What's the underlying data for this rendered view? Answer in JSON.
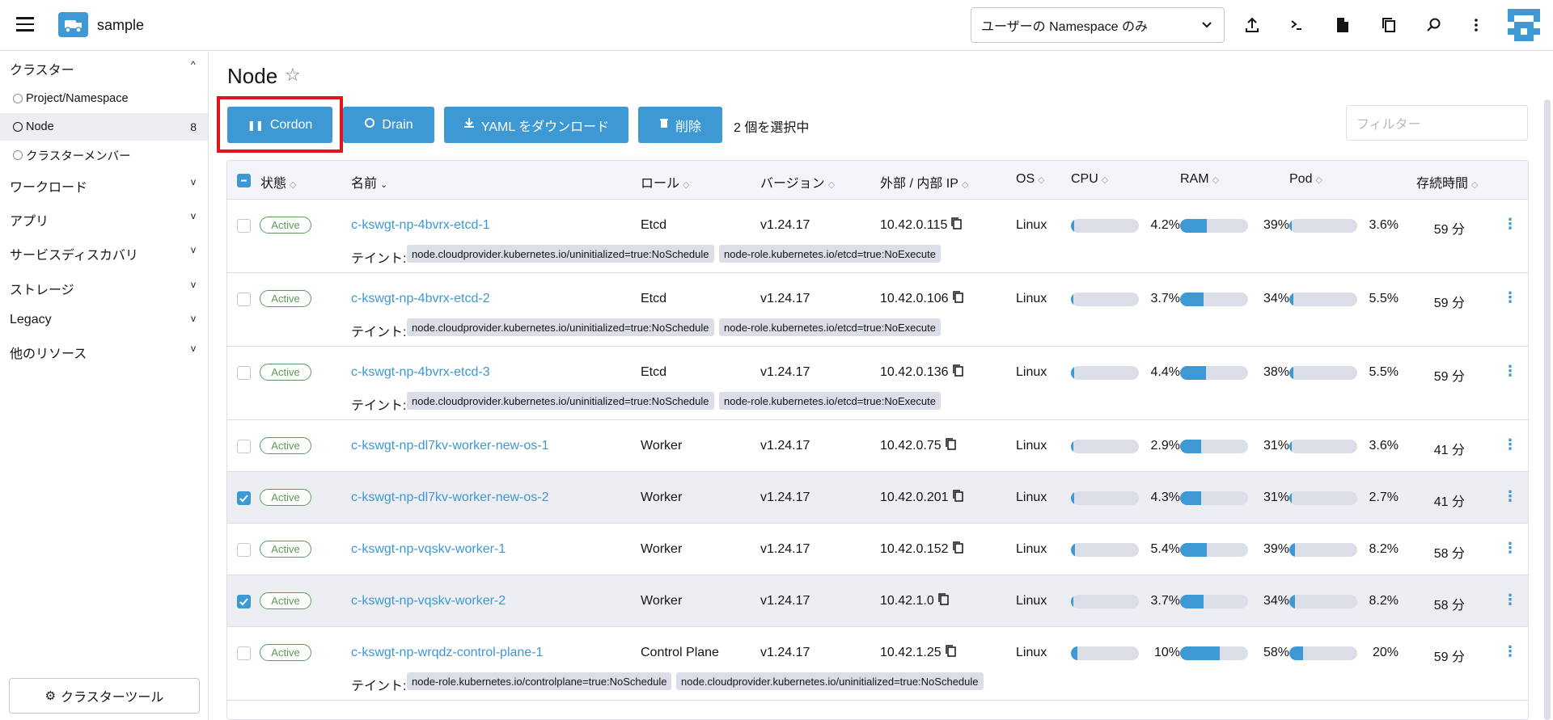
{
  "header": {
    "cluster_name": "sample",
    "namespace_select": "ユーザーの Namespace のみ"
  },
  "sidebar": {
    "groups": [
      {
        "label": "クラスター",
        "caret": "^"
      },
      {
        "label": "ワークロード",
        "caret": "v"
      },
      {
        "label": "アプリ",
        "caret": "v"
      },
      {
        "label": "サービスディスカバリ",
        "caret": "v"
      },
      {
        "label": "ストレージ",
        "caret": "v"
      },
      {
        "label": "Legacy",
        "caret": "v"
      },
      {
        "label": "他のリソース",
        "caret": "v"
      }
    ],
    "cluster_items": [
      {
        "label": "Project/Namespace",
        "count": ""
      },
      {
        "label": "Node",
        "count": "8"
      },
      {
        "label": "クラスターメンバー",
        "count": ""
      }
    ],
    "cluster_tools": "クラスターツール"
  },
  "page": {
    "title": "Node",
    "buttons": {
      "cordon": "Cordon",
      "drain": "Drain",
      "download_yaml": "YAML をダウンロード",
      "delete": "削除"
    },
    "selected_count": "2 個を選択中",
    "filter_placeholder": "フィルター"
  },
  "table": {
    "columns": [
      "状態",
      "名前",
      "ロール",
      "バージョン",
      "外部 / 内部 IP",
      "OS",
      "CPU",
      "RAM",
      "Pod",
      "存続時間"
    ],
    "taint_label": "テイント:",
    "rows": [
      {
        "status": "Active",
        "name": "c-kswgt-np-4bvrx-etcd-1",
        "role": "Etcd",
        "version": "v1.24.17",
        "ip": "10.42.0.115",
        "os": "Linux",
        "cpu": "4.2%",
        "cpu_frac": 0.042,
        "ram": "39%",
        "ram_frac": 0.39,
        "pod": "3.6%",
        "pod_frac": 0.036,
        "age": "59 分",
        "selected": false,
        "taints": [
          "node.cloudprovider.kubernetes.io/uninitialized=true:NoSchedule",
          "node-role.kubernetes.io/etcd=true:NoExecute"
        ]
      },
      {
        "status": "Active",
        "name": "c-kswgt-np-4bvrx-etcd-2",
        "role": "Etcd",
        "version": "v1.24.17",
        "ip": "10.42.0.106",
        "os": "Linux",
        "cpu": "3.7%",
        "cpu_frac": 0.037,
        "ram": "34%",
        "ram_frac": 0.34,
        "pod": "5.5%",
        "pod_frac": 0.055,
        "age": "59 分",
        "selected": false,
        "taints": [
          "node.cloudprovider.kubernetes.io/uninitialized=true:NoSchedule",
          "node-role.kubernetes.io/etcd=true:NoExecute"
        ]
      },
      {
        "status": "Active",
        "name": "c-kswgt-np-4bvrx-etcd-3",
        "role": "Etcd",
        "version": "v1.24.17",
        "ip": "10.42.0.136",
        "os": "Linux",
        "cpu": "4.4%",
        "cpu_frac": 0.044,
        "ram": "38%",
        "ram_frac": 0.38,
        "pod": "5.5%",
        "pod_frac": 0.055,
        "age": "59 分",
        "selected": false,
        "taints": [
          "node.cloudprovider.kubernetes.io/uninitialized=true:NoSchedule",
          "node-role.kubernetes.io/etcd=true:NoExecute"
        ]
      },
      {
        "status": "Active",
        "name": "c-kswgt-np-dl7kv-worker-new-os-1",
        "role": "Worker",
        "version": "v1.24.17",
        "ip": "10.42.0.75",
        "os": "Linux",
        "cpu": "2.9%",
        "cpu_frac": 0.029,
        "ram": "31%",
        "ram_frac": 0.31,
        "pod": "3.6%",
        "pod_frac": 0.036,
        "age": "41 分",
        "selected": false,
        "taints": []
      },
      {
        "status": "Active",
        "name": "c-kswgt-np-dl7kv-worker-new-os-2",
        "role": "Worker",
        "version": "v1.24.17",
        "ip": "10.42.0.201",
        "os": "Linux",
        "cpu": "4.3%",
        "cpu_frac": 0.043,
        "ram": "31%",
        "ram_frac": 0.31,
        "pod": "2.7%",
        "pod_frac": 0.027,
        "age": "41 分",
        "selected": true,
        "taints": []
      },
      {
        "status": "Active",
        "name": "c-kswgt-np-vqskv-worker-1",
        "role": "Worker",
        "version": "v1.24.17",
        "ip": "10.42.0.152",
        "os": "Linux",
        "cpu": "5.4%",
        "cpu_frac": 0.054,
        "ram": "39%",
        "ram_frac": 0.39,
        "pod": "8.2%",
        "pod_frac": 0.082,
        "age": "58 分",
        "selected": false,
        "taints": []
      },
      {
        "status": "Active",
        "name": "c-kswgt-np-vqskv-worker-2",
        "role": "Worker",
        "version": "v1.24.17",
        "ip": "10.42.1.0",
        "os": "Linux",
        "cpu": "3.7%",
        "cpu_frac": 0.037,
        "ram": "34%",
        "ram_frac": 0.34,
        "pod": "8.2%",
        "pod_frac": 0.082,
        "age": "58 分",
        "selected": true,
        "taints": []
      },
      {
        "status": "Active",
        "name": "c-kswgt-np-wrqdz-control-plane-1",
        "role": "Control Plane",
        "version": "v1.24.17",
        "ip": "10.42.1.25",
        "os": "Linux",
        "cpu": "10%",
        "cpu_frac": 0.1,
        "ram": "58%",
        "ram_frac": 0.58,
        "pod": "20%",
        "pod_frac": 0.2,
        "age": "59 分",
        "selected": false,
        "taints": [
          "node-role.kubernetes.io/controlplane=true:NoSchedule",
          "node.cloudprovider.kubernetes.io/uninitialized=true:NoSchedule"
        ]
      }
    ]
  },
  "colors": {
    "accent": "#3d98d3",
    "active_badge": "#5d995d",
    "highlight": "#e1141e"
  }
}
